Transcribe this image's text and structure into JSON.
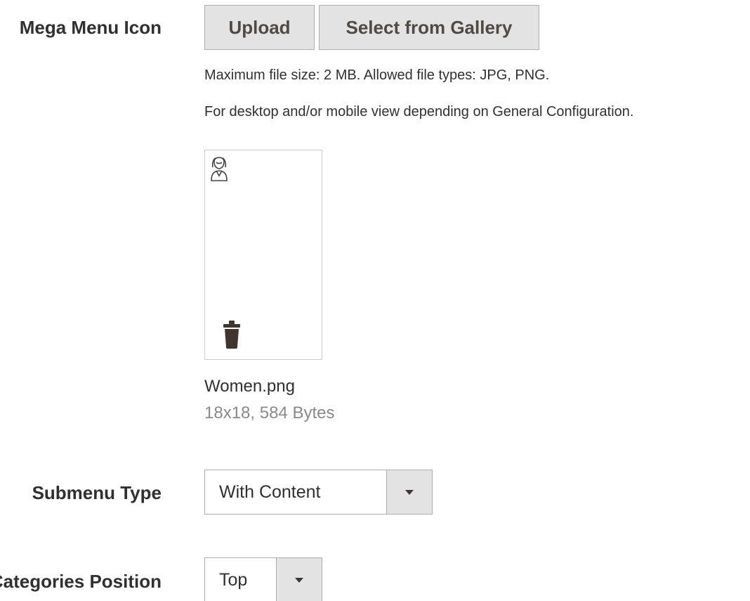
{
  "mega_menu_icon": {
    "label": "Mega Menu Icon",
    "upload_label": "Upload",
    "gallery_label": "Select from Gallery",
    "note_size": "Maximum file size: 2 MB. Allowed file types: JPG, PNG.",
    "note_view": "For desktop and/or mobile view depending on General Configuration.",
    "thumbnail_icon": "woman-icon",
    "delete_icon": "trash-icon",
    "file": {
      "name": "Women.png",
      "meta": "18x18, 584 Bytes"
    }
  },
  "submenu_type": {
    "label": "Submenu Type",
    "value": "With Content"
  },
  "categories_position": {
    "label": "Categories Position",
    "value": "Top"
  },
  "colors": {
    "button_bg": "#e3e3e3",
    "button_text": "#514943",
    "border": "#adadad",
    "muted_text": "#8a8a8a",
    "trash_icon": "#41362f"
  }
}
